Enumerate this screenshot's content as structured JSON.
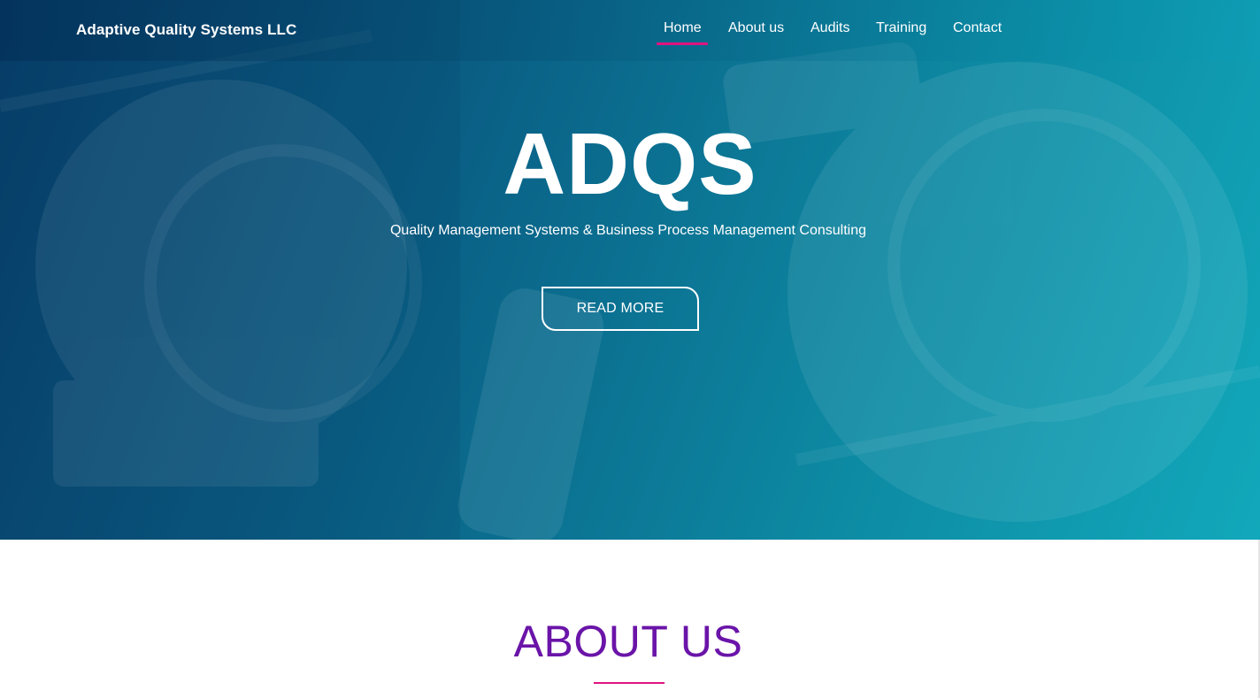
{
  "navbar": {
    "brand": "Adaptive Quality Systems LLC",
    "links": [
      {
        "label": "Home",
        "active": true
      },
      {
        "label": "About us",
        "active": false
      },
      {
        "label": "Audits",
        "active": false
      },
      {
        "label": "Training",
        "active": false
      },
      {
        "label": "Contact",
        "active": false
      }
    ],
    "active_indicator_color": "#e0137f"
  },
  "hero": {
    "title": "ADQS",
    "subtitle": "Quality Management Systems & Business Process Management Consulting",
    "button_label": "READ MORE",
    "overlay_colors": [
      "#063f6a",
      "#12a8bb"
    ]
  },
  "about": {
    "title": "ABOUT US",
    "title_color": "#6a14a8",
    "underline_color": "#e0137f"
  }
}
